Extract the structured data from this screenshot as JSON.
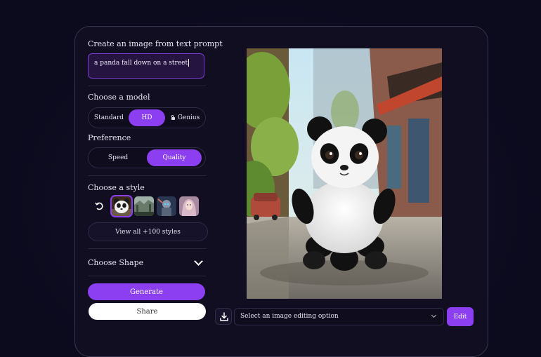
{
  "prompt_section": {
    "title": "Create an image from text prompt",
    "value": "a panda fall down on a street"
  },
  "model": {
    "title": "Choose a model",
    "options": [
      "Standard",
      "HD",
      "Genius"
    ],
    "selected": "HD",
    "locked": "Genius"
  },
  "preference": {
    "title": "Preference",
    "options": [
      "Speed",
      "Quality"
    ],
    "selected": "Quality"
  },
  "style": {
    "title": "Choose a style",
    "thumbs": [
      "reset-style-icon",
      "panda-style-thumb",
      "landscape-style-thumb",
      "robot-style-thumb",
      "portrait-style-thumb"
    ],
    "view_all": "View all +100 styles"
  },
  "shape": {
    "title": "Choose Shape"
  },
  "actions": {
    "generate": "Generate",
    "share": "Share"
  },
  "editor": {
    "select_placeholder": "Select an image editing option",
    "edit": "Edit"
  },
  "colors": {
    "accent": "#8b3ff0",
    "background": "#0c0a1d",
    "card": "#110e22"
  }
}
